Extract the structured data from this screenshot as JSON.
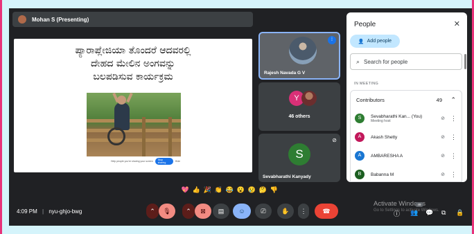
{
  "presenter": {
    "name": "Mohan S (Presenting)"
  },
  "slide": {
    "title_lines": [
      "ಪ್ಯಾರಾಪ್ಲೇಜಿಯಾ ತೊಂದರೆ ಆದವರಲ್ಲಿ",
      "ದೇಹದ ಮೇಲಿನ ಅಂಗವನ್ನು",
      "ಬಲಪಡಿಸುವ ಕಾರ್ಯಕ್ರಮ"
    ],
    "bar_text": "Help people you're sharing your screen",
    "stop_label": "Stop sharing",
    "hide_label": "Hide"
  },
  "tiles": [
    {
      "name": "Rajesh Navada G V",
      "speaking": true
    },
    {
      "avatar_letter": "Y",
      "label": "46 others"
    },
    {
      "avatar_letter": "S",
      "name": "Sevabharathi Kanyady",
      "muted": true
    }
  ],
  "people": {
    "title": "People",
    "add_label": "Add people",
    "search_placeholder": "Search for people",
    "section": "IN MEETING",
    "group": "Contributors",
    "count": "49",
    "participants": [
      {
        "letter": "S",
        "name": "Sevabharathi Kan... (You)",
        "sub": "Meeting host",
        "color": "#2e7d32"
      },
      {
        "letter": "A",
        "name": "Akash Shetty",
        "sub": "",
        "color": "#c2185b"
      },
      {
        "letter": "A",
        "name": "AMBARESHA A",
        "sub": "",
        "color": "#1976d2"
      },
      {
        "letter": "B",
        "name": "Babanna M",
        "sub": "",
        "color": "#1b5e20"
      }
    ]
  },
  "reactions": [
    "💖",
    "👍",
    "🎉",
    "👏",
    "😂",
    "😮",
    "😢",
    "🤔",
    "👎"
  ],
  "bottom": {
    "time": "4:09 PM",
    "code": "nyu-ghjo-bwg",
    "people_badge": "49"
  },
  "watermark": {
    "line1": "Activate Windows",
    "line2": "Go to Settings to activate Windows."
  },
  "colors": {
    "meet_bg": "#202124",
    "tile_bg": "#3c4043",
    "end_call": "#ea4335",
    "active_border": "#8ab4f8",
    "page_bg": "#d5f4fb"
  }
}
